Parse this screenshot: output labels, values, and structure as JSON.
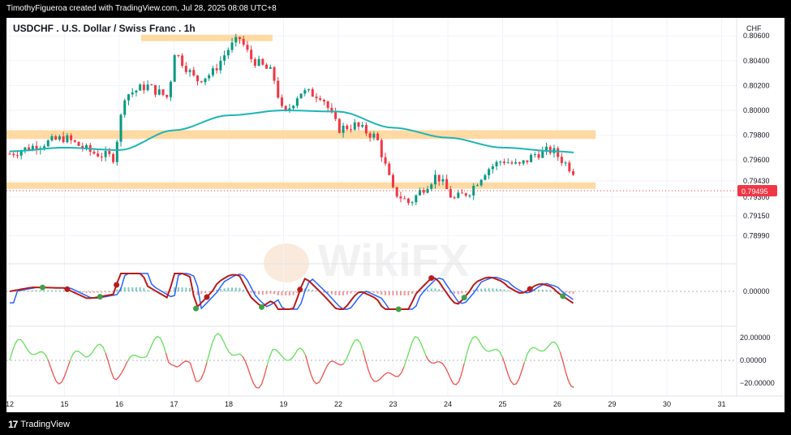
{
  "header": {
    "credit": "TimothyFigueroa created with TradingView.com, Jul 28, 2025 08:08 UTC+8"
  },
  "footer": {
    "brand": "TradingView"
  },
  "watermark": "WikiFX",
  "chart_data": {
    "type": "candlestick",
    "title": "USDCHF . U.S. Dollar / Swiss Franc . 1h",
    "currency": "CHF",
    "price_axis_ticks": [
      "0.80600",
      "0.80400",
      "0.80200",
      "0.80000",
      "0.79800",
      "0.79600",
      "0.79430",
      "0.79300",
      "0.79150",
      "0.78990"
    ],
    "macd_axis_ticks": [
      "0.00000"
    ],
    "oscillator_axis_ticks": [
      "20.00000",
      "0.00000",
      "−20.00000"
    ],
    "last_price": "0.79495",
    "x_ticks": [
      "12",
      "15",
      "16",
      "17",
      "18",
      "19",
      "22",
      "23",
      "24",
      "25",
      "26",
      "29",
      "30",
      "31"
    ],
    "ylim": [
      0.7881,
      0.8068
    ],
    "support_resistance_zones": [
      [
        0.8056,
        0.8061
      ],
      [
        0.7977,
        0.7984
      ],
      [
        0.7937,
        0.7942
      ]
    ],
    "close_path_day_index": [
      [
        0,
        0.7965
      ],
      [
        0.5,
        0.7972
      ],
      [
        1,
        0.7978
      ],
      [
        1.5,
        0.7966
      ],
      [
        1.9,
        0.7962
      ],
      [
        2.1,
        0.8012
      ],
      [
        2.5,
        0.802
      ],
      [
        2.9,
        0.801
      ],
      [
        3.0,
        0.8048
      ],
      [
        3.4,
        0.8024
      ],
      [
        3.7,
        0.803
      ],
      [
        4.0,
        0.805
      ],
      [
        4.2,
        0.8058
      ],
      [
        4.4,
        0.8042
      ],
      [
        4.8,
        0.803
      ],
      [
        5.0,
        0.7995
      ],
      [
        5.3,
        0.8015
      ],
      [
        5.7,
        0.8012
      ],
      [
        6.0,
        0.7985
      ],
      [
        6.3,
        0.7988
      ],
      [
        6.7,
        0.7978
      ],
      [
        7.0,
        0.7935
      ],
      [
        7.3,
        0.7925
      ],
      [
        7.5,
        0.7935
      ],
      [
        7.8,
        0.7948
      ],
      [
        8.1,
        0.7928
      ],
      [
        8.4,
        0.7935
      ],
      [
        8.7,
        0.7952
      ],
      [
        9.0,
        0.796
      ],
      [
        9.3,
        0.7955
      ],
      [
        9.6,
        0.7965
      ],
      [
        9.9,
        0.7968
      ],
      [
        10.2,
        0.7955
      ],
      [
        10.35,
        0.7949
      ]
    ],
    "moving_average_day_index": [
      [
        0,
        0.7967
      ],
      [
        1,
        0.797
      ],
      [
        2,
        0.7968
      ],
      [
        3,
        0.7984
      ],
      [
        4,
        0.7996
      ],
      [
        5,
        0.8
      ],
      [
        6,
        0.7999
      ],
      [
        7,
        0.7986
      ],
      [
        8,
        0.7978
      ],
      [
        9,
        0.797
      ],
      [
        10,
        0.7967
      ],
      [
        10.35,
        0.7966
      ]
    ]
  }
}
